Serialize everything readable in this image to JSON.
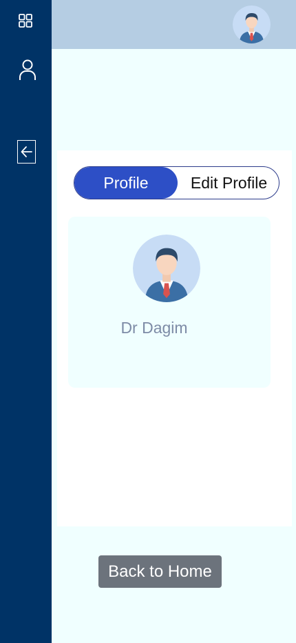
{
  "sidebar": {
    "icons": [
      "grid-icon",
      "user-icon",
      "arrow-left-icon"
    ]
  },
  "header": {
    "avatar_icon": "doctor-avatar-icon"
  },
  "tabs": {
    "profile_label": "Profile",
    "edit_label": "Edit Profile"
  },
  "profile": {
    "name": "Dr Dagim",
    "avatar_icon": "doctor-avatar-icon"
  },
  "actions": {
    "back_label": "Back to Home"
  },
  "colors": {
    "sidebar": "#003366",
    "topbar": "#b5cde3",
    "active_tab": "#2d4fc6",
    "button": "#6c737c",
    "page_bg": "#f0ffff"
  }
}
